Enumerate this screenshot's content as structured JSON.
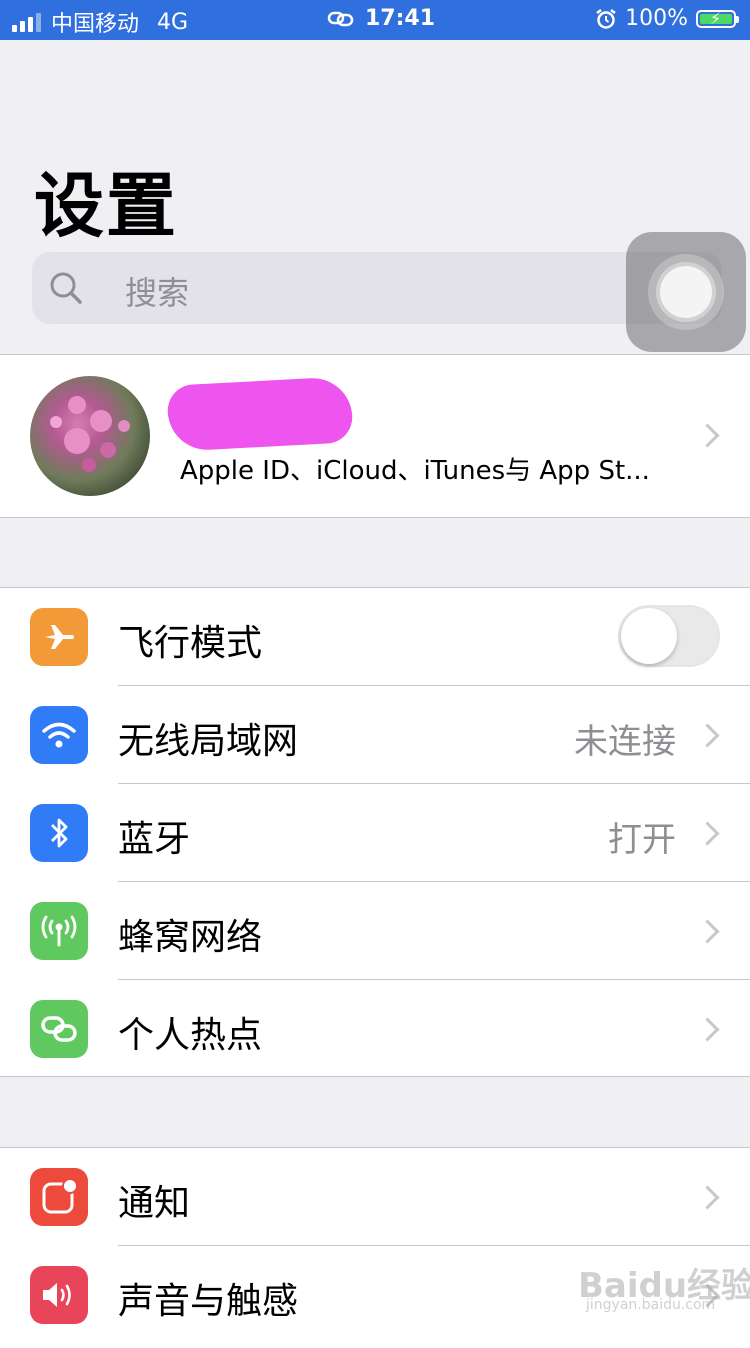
{
  "status_bar": {
    "carrier": "中国移动",
    "network": "4G",
    "time": "17:41",
    "battery_percent": "100%",
    "signal_level_of_4": 3,
    "icons": [
      "signal-icon",
      "hotspot-link-icon",
      "alarm-icon",
      "battery-charging-icon"
    ],
    "background_color": "#2f6fde"
  },
  "header": {
    "title": "设置"
  },
  "search": {
    "placeholder": "搜索"
  },
  "profile": {
    "subtitle": "Apple ID、iCloud、iTunes与 App St..."
  },
  "groups": [
    {
      "items": [
        {
          "label": "飞行模式",
          "icon": "airplane-icon",
          "icon_color": "#f19a37",
          "toggle_on": false
        },
        {
          "label": "无线局域网",
          "icon": "wifi-icon",
          "icon_color": "#2f7cf6",
          "value": "未连接"
        },
        {
          "label": "蓝牙",
          "icon": "bluetooth-icon",
          "icon_color": "#2f7cf6",
          "value": "打开"
        },
        {
          "label": "蜂窝网络",
          "icon": "cellular-antenna-icon",
          "icon_color": "#5fc85f"
        },
        {
          "label": "个人热点",
          "icon": "hotspot-icon",
          "icon_color": "#5fc85f"
        }
      ]
    },
    {
      "items": [
        {
          "label": "通知",
          "icon": "notification-icon",
          "icon_color": "#ec4b3c"
        },
        {
          "label": "声音与触感",
          "icon": "speaker-icon",
          "icon_color": "#e8445a"
        }
      ]
    }
  ],
  "watermark": {
    "text": "Baidu经验",
    "sub": "jingyan.baidu.com"
  }
}
